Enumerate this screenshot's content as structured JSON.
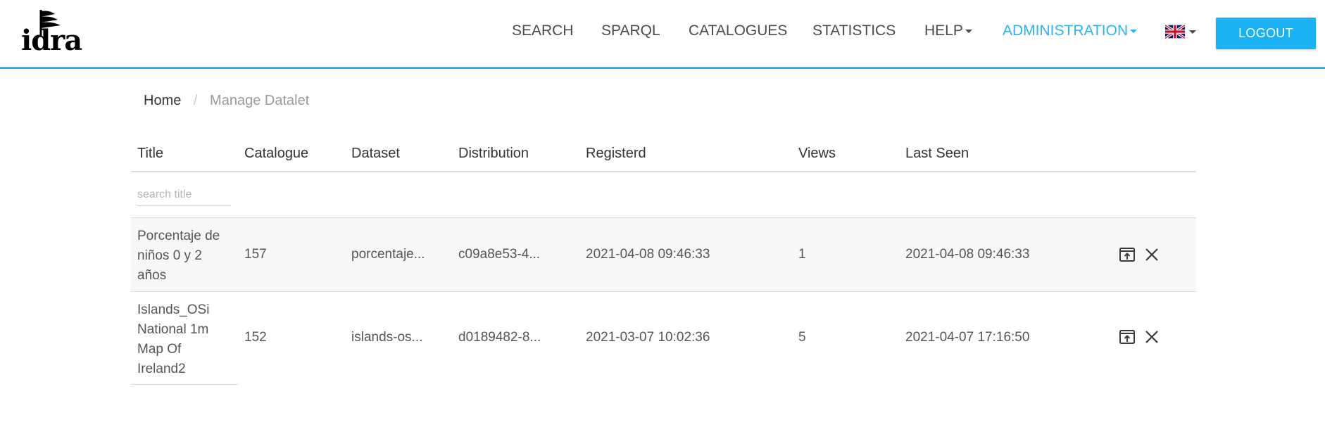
{
  "logo": {
    "text": "idra"
  },
  "nav": {
    "items": [
      {
        "label": "SEARCH"
      },
      {
        "label": "SPARQL"
      },
      {
        "label": "CATALOGUES"
      },
      {
        "label": "STATISTICS"
      },
      {
        "label": "HELP"
      },
      {
        "label": "ADMINISTRATION"
      }
    ],
    "language_flag": "uk-flag-icon",
    "logout_label": "LOGOUT",
    "accent_color": "#2bb3f3"
  },
  "breadcrumb": {
    "home": "Home",
    "separator": "/",
    "current": "Manage Datalet"
  },
  "table": {
    "headers": [
      "Title",
      "Catalogue",
      "Dataset",
      "Distribution",
      "Registerd",
      "Views",
      "Last Seen"
    ],
    "search_placeholder": "search title",
    "rows": [
      {
        "title": "Porcentaje de niños 0 y 2 años",
        "catalogue": "157",
        "dataset": "porcentaje...",
        "distribution": "c09a8e53-4...",
        "registered": "2021-04-08 09:46:33",
        "views": "1",
        "last_seen": "2021-04-08 09:46:33"
      },
      {
        "title": "Islands_OSi National 1m Map Of Ireland2",
        "catalogue": "152",
        "dataset": "islands-os...",
        "distribution": "d0189482-8...",
        "registered": "2021-03-07 10:02:36",
        "views": "5",
        "last_seen": "2021-04-07 17:16:50"
      }
    ]
  }
}
